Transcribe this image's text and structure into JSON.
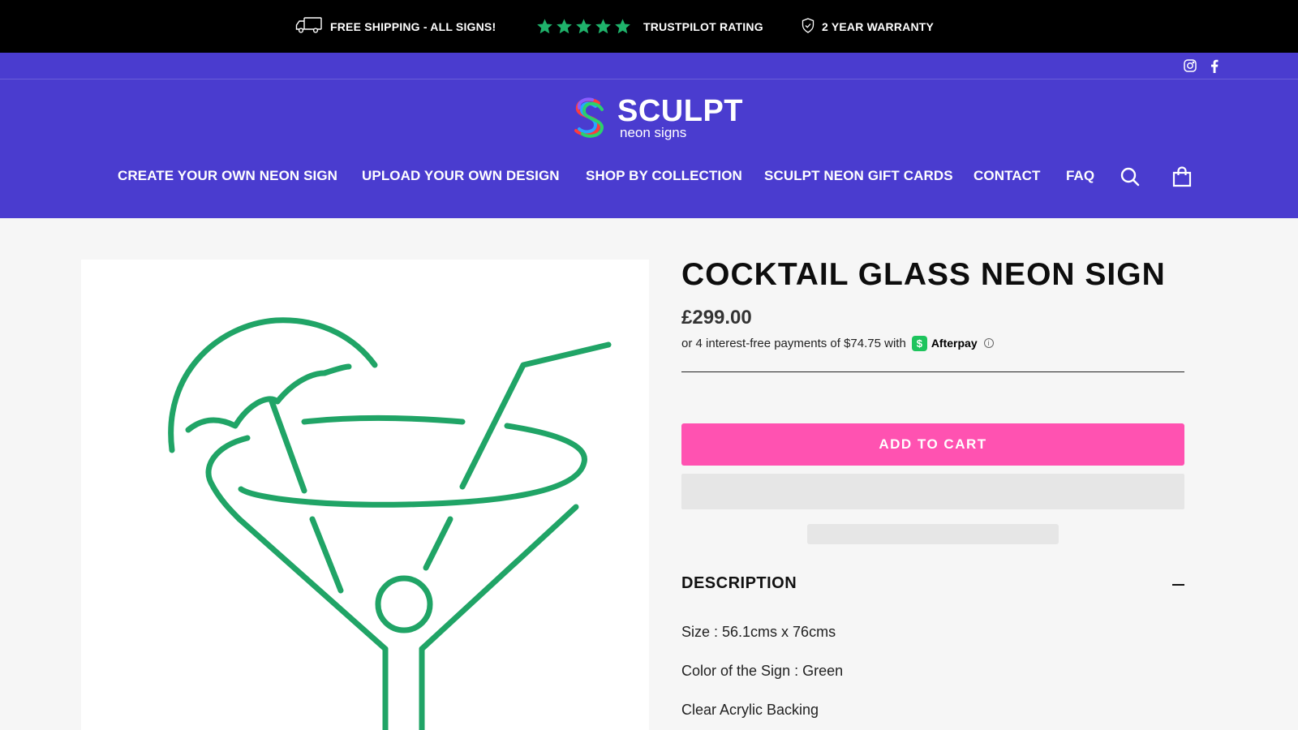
{
  "announcement": {
    "shipping": "FREE SHIPPING - ALL SIGNS!",
    "trustpilot": "TRUSTPILOT RATING",
    "warranty": "2 YEAR WARRANTY",
    "stars": 5,
    "star_color": "#1fb36b"
  },
  "header": {
    "background": "#4a3ccf",
    "logo": {
      "word": "SCULPT",
      "sub": "neon signs"
    },
    "social": [
      "instagram-icon",
      "facebook-icon"
    ],
    "nav": [
      "CREATE YOUR OWN NEON SIGN",
      "UPLOAD YOUR OWN DESIGN",
      "SHOP BY COLLECTION",
      "SCULPT NEON GIFT CARDS",
      "CONTACT",
      "FAQ"
    ],
    "icons": [
      "search-icon",
      "cart-icon"
    ]
  },
  "product": {
    "title": "COCKTAIL GLASS NEON SIGN",
    "price": "£299.00",
    "afterpay_text": "or 4 interest-free payments of $74.75 with",
    "afterpay_brand": "Afterpay",
    "afterpay_badge": "$",
    "add_to_cart": "ADD TO CART",
    "button_color": "#ff52b1",
    "image_line_color": "#20a466",
    "description": {
      "heading": "DESCRIPTION",
      "lines": [
        "Size : 56.1cms x 76cms",
        "Color of the Sign : Green",
        "Clear Acrylic Backing"
      ]
    }
  }
}
